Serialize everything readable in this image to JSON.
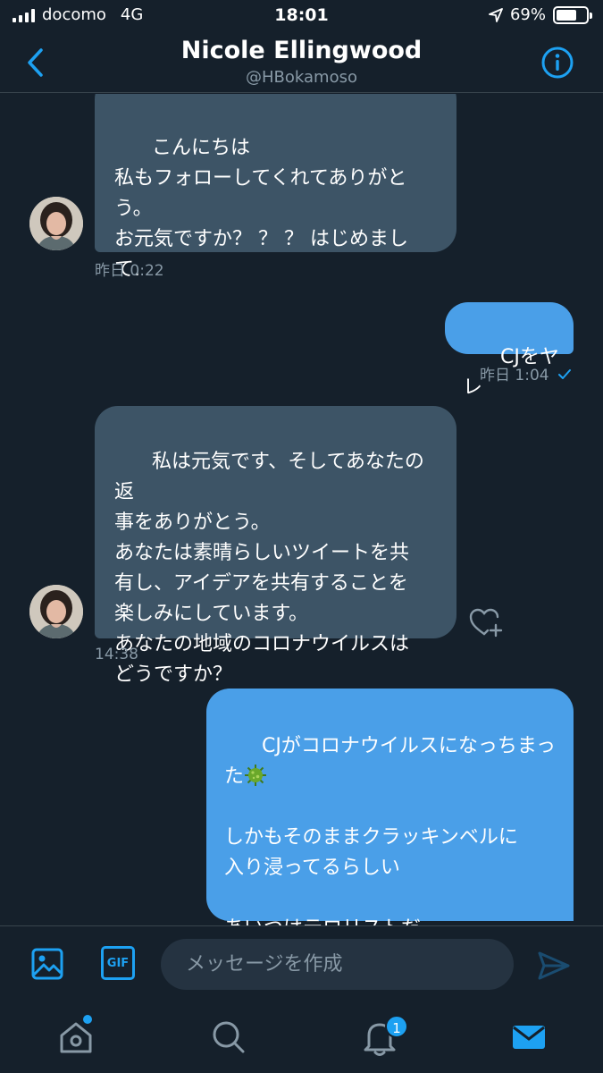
{
  "status_bar": {
    "carrier": "docomo",
    "network": "4G",
    "time": "18:01",
    "battery": "69%",
    "battery_level": 0.69
  },
  "header": {
    "name": "Nicole Ellingwood",
    "handle": "@HBokamoso"
  },
  "messages": [
    {
      "direction": "in",
      "text": "こんにちは\n私もフォローしてくれてありがと\nう。\nお元気ですか？ ？ ？ はじめまし\nて.",
      "time": "昨日 0:22"
    },
    {
      "direction": "out",
      "text": "CJをヤレ",
      "time": "昨日 1:04"
    },
    {
      "direction": "in",
      "text": "私は元気です、そしてあなたの返\n事をありがとう。\nあなたは素晴らしいツイートを共\n有し、アイデアを共有することを\n楽しみにしています。\nあなたの地域のコロナウイルスは\nどうですか？",
      "time": "14:38"
    },
    {
      "direction": "out",
      "line1": "CJがコロナウイルスになっちまっ",
      "line2": "た",
      "rest": "しかもそのままクラッキンベルに\n入り浸ってるらしい\n\nあいつはテロリストだ"
    }
  ],
  "composer": {
    "placeholder": "メッセージを作成",
    "gif_label": "GIF"
  },
  "tabbar": {
    "notification_count": "1"
  },
  "colors": {
    "background": "#15202b",
    "accent": "#1da1f2",
    "incoming_bubble": "#3d5466",
    "outgoing_bubble": "#4a9fe8",
    "secondary_text": "#8899a6"
  }
}
